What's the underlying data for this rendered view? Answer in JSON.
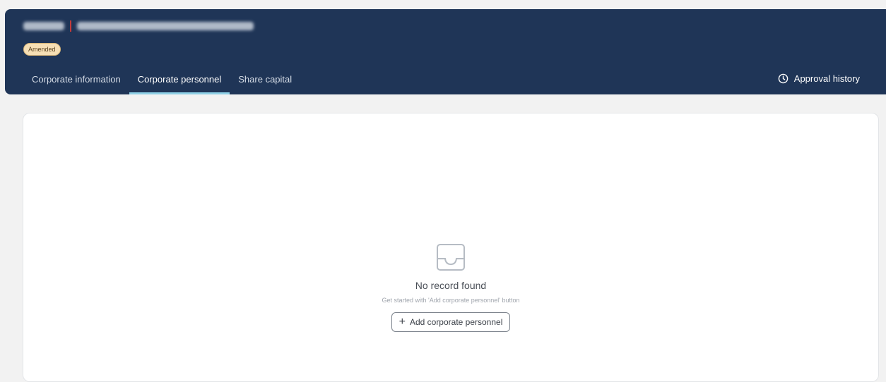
{
  "header": {
    "badge": "Amended",
    "tabs": [
      {
        "label": "Corporate information",
        "active": false
      },
      {
        "label": "Corporate personnel",
        "active": true
      },
      {
        "label": "Share capital",
        "active": false
      }
    ],
    "approval_history": "Approval history",
    "icons": {
      "approval": "clock-icon"
    }
  },
  "empty_state": {
    "icon": "inbox-icon",
    "title": "No record found",
    "subtitle": "Get started with 'Add corporate personnel' button",
    "button_label": "Add corporate personnel",
    "button_icon": "plus-icon"
  },
  "colors": {
    "header_bg": "#1f3557",
    "active_tab_underline": "#8fd0e6",
    "badge_bg": "#f6dfb5",
    "page_bg": "#f2f2f2"
  }
}
